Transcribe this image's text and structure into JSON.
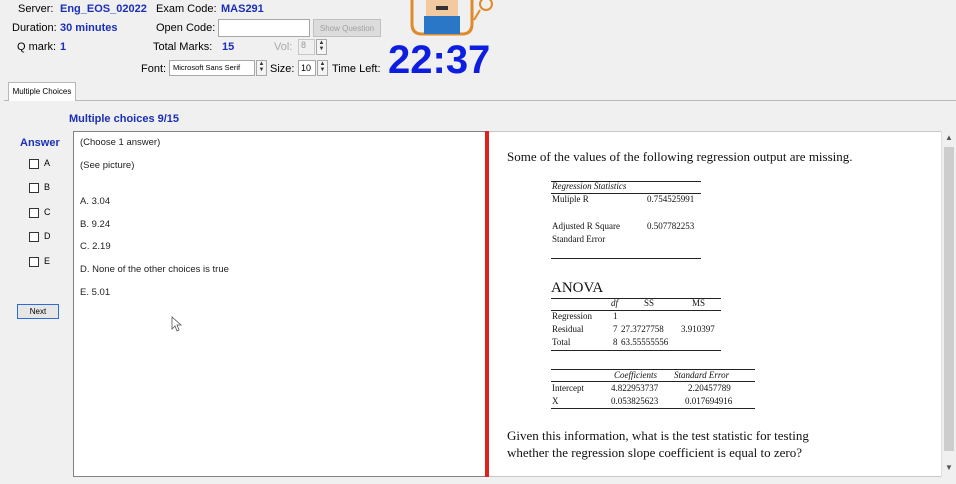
{
  "header": {
    "server_label": "Server:",
    "server_value": "Eng_EOS_02022",
    "exam_code_label": "Exam Code:",
    "exam_code_value": "MAS291",
    "duration_label": "Duration:",
    "duration_value": "30 minutes",
    "open_code_label": "Open Code:",
    "open_code_value": "",
    "show_question_label": "Show Question",
    "qmark_label": "Q mark:",
    "qmark_value": "1",
    "total_marks_label": "Total Marks:",
    "total_marks_value": "15",
    "vol_label": "Vol:",
    "vol_value": "8",
    "font_label": "Font:",
    "font_value": "Microsoft Sans Serif",
    "size_label": "Size:",
    "size_value": "10",
    "time_left_label": "Time Left:",
    "timer": "22:37"
  },
  "tabs": [
    {
      "label": "Multiple Choices"
    }
  ],
  "question_header": "Multiple choices 9/15",
  "answer": {
    "title": "Answer",
    "options": [
      "A",
      "B",
      "C",
      "D",
      "E"
    ],
    "next_label": "Next"
  },
  "left_panel": {
    "instruction": "(Choose 1 answer)",
    "see_picture": "(See picture)",
    "choices": [
      "A. 3.04",
      "B. 9.24",
      "C. 2.19",
      "D. None of the other choices is true",
      "E. 5.01"
    ]
  },
  "question": {
    "intro": "Some of the values of the following regression output are missing.",
    "reg_stats_title": "Regression Statistics",
    "multiple_r_label": "Muliple R",
    "multiple_r_value": "0.754525991",
    "adj_r2_label": "Adjusted R Square",
    "adj_r2_value": "0.507782253",
    "std_err_label": "Standard Error",
    "anova_title": "ANOVA",
    "anova_headers": [
      "df",
      "SS",
      "MS"
    ],
    "anova_rows": [
      {
        "label": "Regression",
        "df": "1",
        "ss": "",
        "ms": ""
      },
      {
        "label": "Residual",
        "df": "7",
        "ss": "27.3727758",
        "ms": "3.910397"
      },
      {
        "label": "Total",
        "df": "8",
        "ss": "63.55555556",
        "ms": ""
      }
    ],
    "coef_headers": [
      "Coefficients",
      "Standard Error"
    ],
    "coef_rows": [
      {
        "label": "Intercept",
        "coef": "4.822953737",
        "se": "2.20457789"
      },
      {
        "label": "X",
        "coef": "0.053825623",
        "se": "0.017694916"
      }
    ],
    "closing_line1": "Given this information, what is the test statistic for testing",
    "closing_line2": "whether the regression slope coefficient is equal to zero?"
  }
}
